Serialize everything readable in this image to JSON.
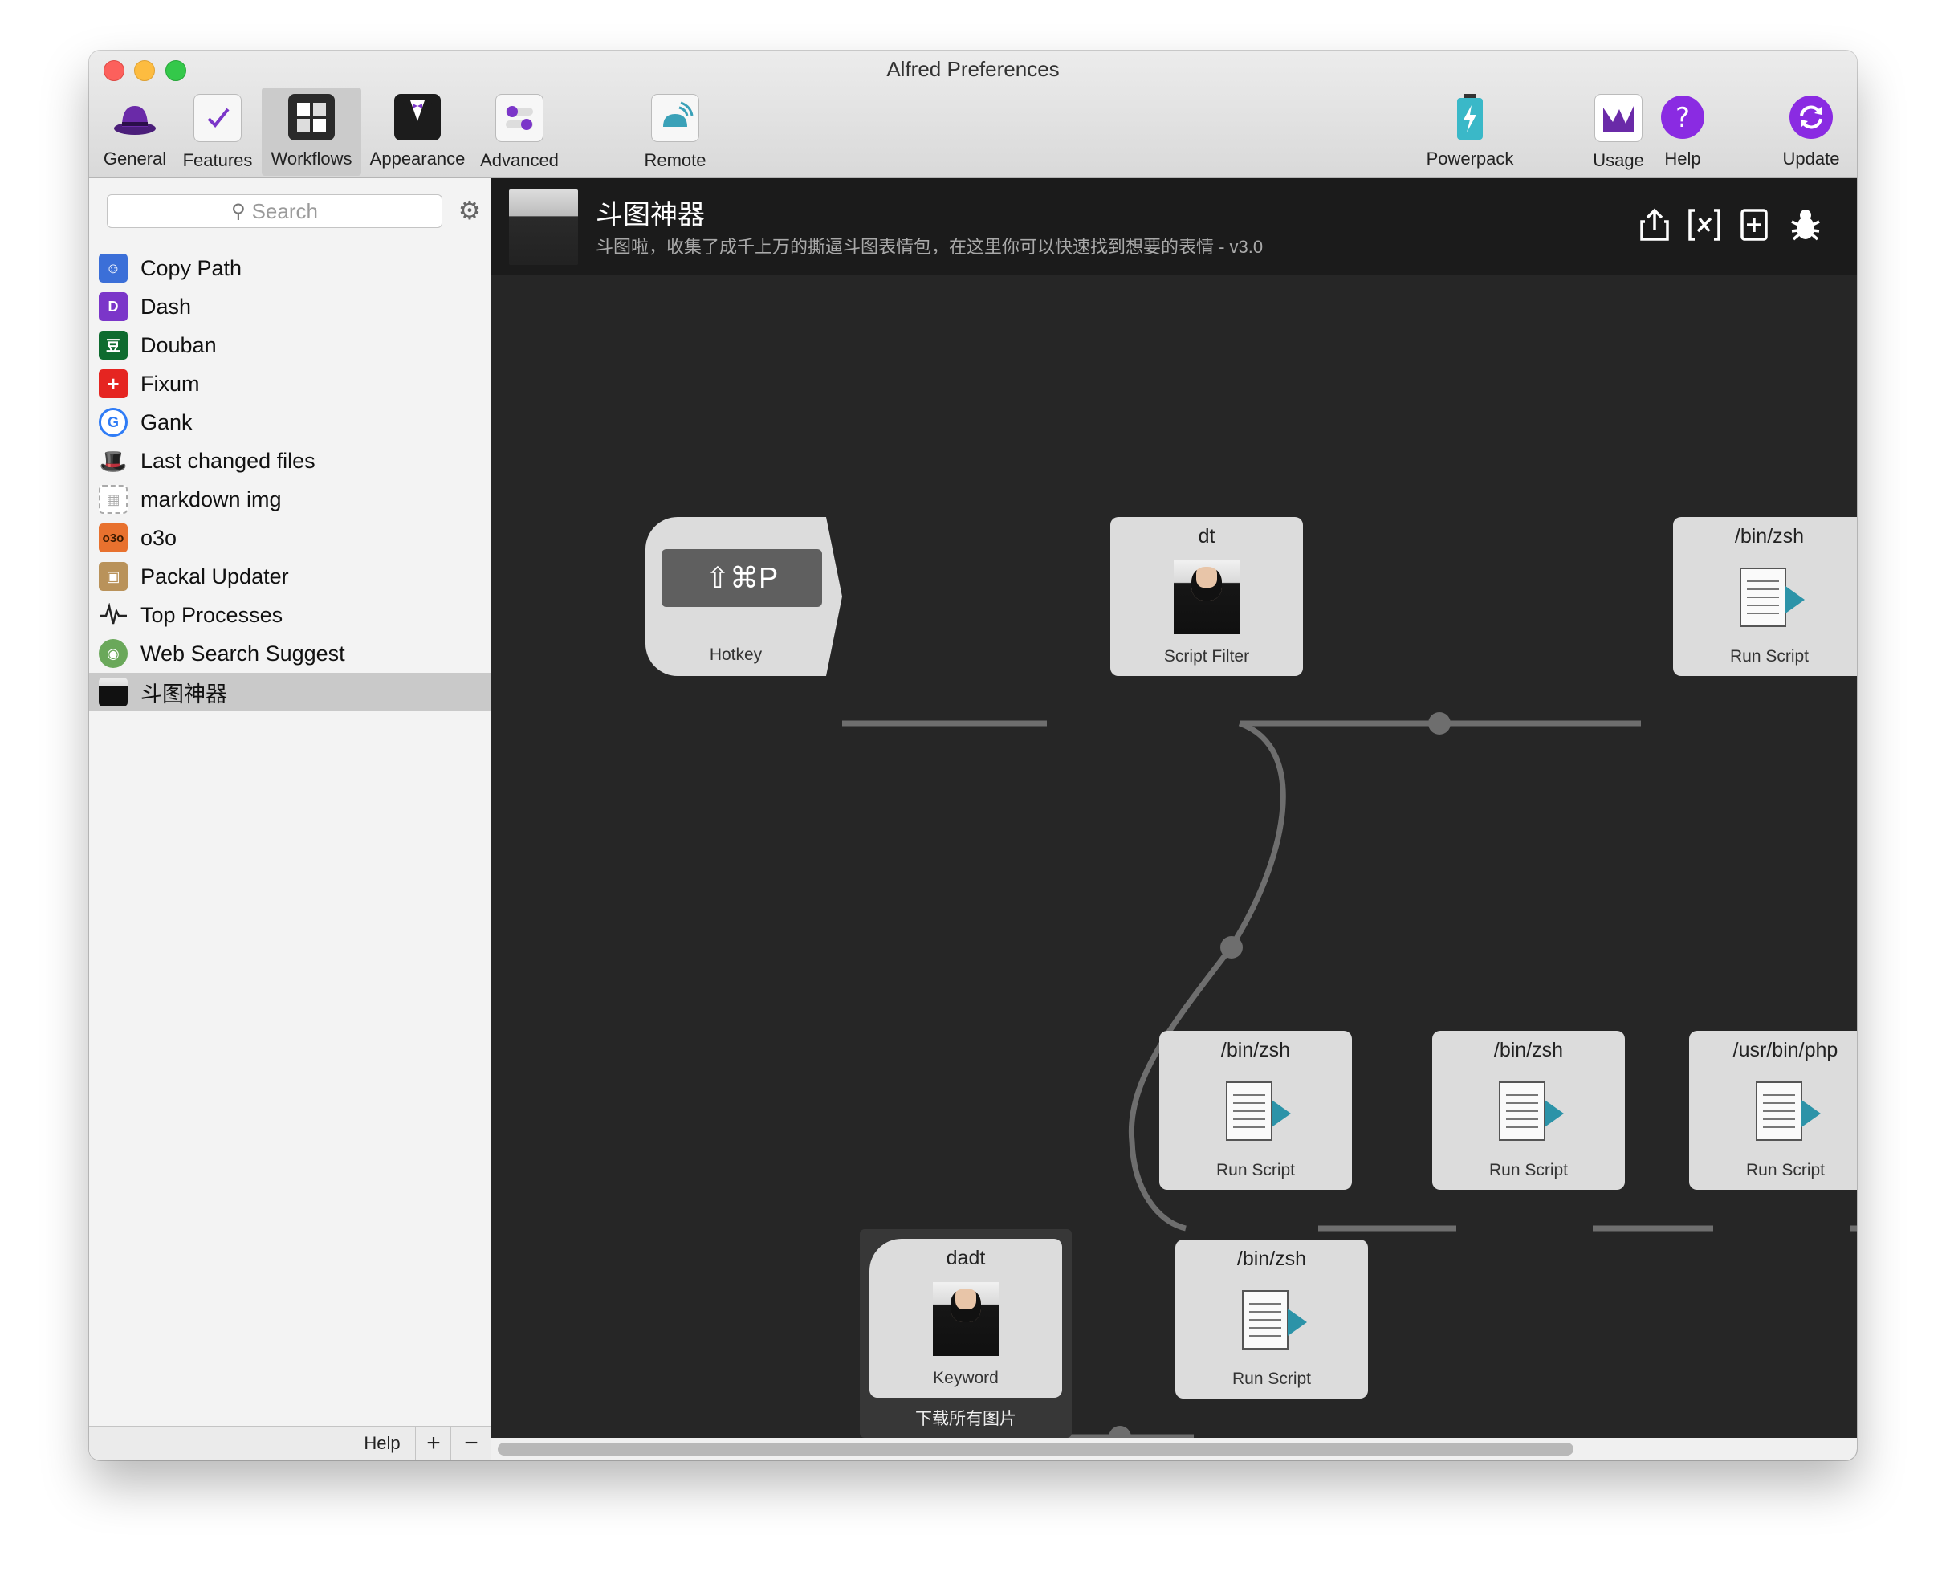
{
  "window": {
    "title": "Alfred Preferences"
  },
  "toolbar": {
    "items": [
      {
        "label": "General",
        "icon": "hat-icon"
      },
      {
        "label": "Features",
        "icon": "checklist-icon"
      },
      {
        "label": "Workflows",
        "icon": "workflows-grid-icon"
      },
      {
        "label": "Appearance",
        "icon": "tuxedo-icon"
      },
      {
        "label": "Advanced",
        "icon": "toggles-icon"
      },
      {
        "label": "Remote",
        "icon": "remote-icon"
      },
      {
        "label": "Powerpack",
        "icon": "battery-icon"
      },
      {
        "label": "Usage",
        "icon": "usage-chart-icon"
      },
      {
        "label": "Help",
        "icon": "help-icon"
      },
      {
        "label": "Update",
        "icon": "update-icon"
      }
    ],
    "selected": "Workflows"
  },
  "sidebar": {
    "search_placeholder": "Search",
    "items": [
      {
        "label": "Copy Path",
        "icon": "finder-icon",
        "color": "#3b6fd8"
      },
      {
        "label": "Dash",
        "icon": "dash-icon",
        "color": "#7b36c9"
      },
      {
        "label": "Douban",
        "icon": "douban-icon",
        "color": "#0e6b2f"
      },
      {
        "label": "Fixum",
        "icon": "swiss-cross-icon",
        "color": "#e52521"
      },
      {
        "label": "Gank",
        "icon": "g-icon",
        "color": "#2f7cf6"
      },
      {
        "label": "Last changed files",
        "icon": "magic-hat-icon",
        "color": "#222222"
      },
      {
        "label": "markdown img",
        "icon": "placeholder-grid-icon",
        "color": "#d8d8d8"
      },
      {
        "label": "o3o",
        "icon": "o3o-icon",
        "color": "#e8712e"
      },
      {
        "label": "Packal Updater",
        "icon": "package-icon",
        "color": "#b9925a"
      },
      {
        "label": "Top Processes",
        "icon": "pulse-icon",
        "color": "#333333"
      },
      {
        "label": "Web Search Suggest",
        "icon": "globe-icon",
        "color": "#6aa85a"
      },
      {
        "label": "斗图神器",
        "icon": "portrait-icon",
        "color": "#1a1a1a"
      }
    ],
    "selected_index": 11,
    "footer": {
      "help": "Help",
      "add": "+",
      "remove": "−"
    }
  },
  "workflow": {
    "name": "斗图神器",
    "description": "斗图啦，收集了成千上万的撕逼斗图表情包，在这里你可以快速找到想要的表情 - v3.0",
    "nodes": {
      "hotkey": {
        "key": "⇧⌘P",
        "label": "Hotkey"
      },
      "script_filter": {
        "title": "dt",
        "label": "Script Filter"
      },
      "run_script_top": {
        "title": "/bin/zsh",
        "label": "Run Script"
      },
      "run_script_mid1": {
        "title": "/bin/zsh",
        "label": "Run Script"
      },
      "run_script_mid2": {
        "title": "/bin/zsh",
        "label": "Run Script"
      },
      "run_script_php": {
        "title": "/usr/bin/php",
        "label": "Run Script"
      },
      "keyword": {
        "title": "dadt",
        "label": "Keyword",
        "caption": "下载所有图片"
      },
      "run_script_bottom": {
        "title": "/bin/zsh",
        "label": "Run Script"
      }
    }
  }
}
